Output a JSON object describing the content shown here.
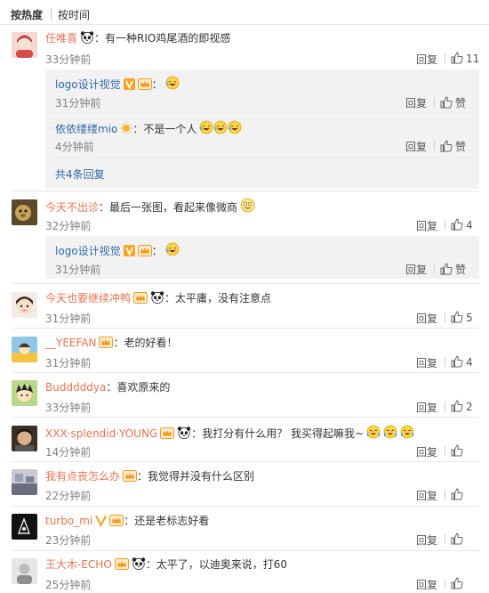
{
  "tabs": {
    "hot": "按热度",
    "time": "按时间"
  },
  "comments": [
    {
      "user": "任唯喜",
      "text": "：有一种RIO鸡尾酒的即视感",
      "time": "33分钟前",
      "reply": "回复",
      "likes": "11"
    },
    {
      "user": "今天不出诊",
      "text": "：最后一张图，看起来像微商",
      "time": "32分钟前",
      "reply": "回复",
      "likes": "4"
    },
    {
      "user": "今天也要继续冲鸭",
      "text": "：太平庸，没有注意点",
      "time": "31分钟前",
      "reply": "回复",
      "likes": "5"
    },
    {
      "user": "__YEEFAN",
      "text": "：老的好看！",
      "time": "31分钟前",
      "reply": "回复",
      "likes": "4"
    },
    {
      "user": "Budddddya",
      "text": "：喜欢原来的",
      "time": "33分钟前",
      "reply": "回复",
      "likes": "2"
    },
    {
      "user": "XXX·splendid·YOUNG",
      "text": "：我打分有什么用？ 我买得起嘛我~",
      "time": "14分钟前",
      "reply": "回复",
      "likes": ""
    },
    {
      "user": "我有点丧怎么办",
      "text": "：我觉得并没有什么区别",
      "time": "22分钟前",
      "reply": "回复",
      "likes": ""
    },
    {
      "user": "turbo_mi",
      "text": "：还是老标志好看",
      "time": "23分钟前",
      "reply": "回复",
      "likes": ""
    },
    {
      "user": "王大木-ECHO",
      "text": "：太平了，以迪奥来说，打60",
      "time": "25分钟前",
      "reply": "回复",
      "likes": ""
    }
  ],
  "replies": [
    {
      "user": "logo设计视觉",
      "text": "：",
      "time": "31分钟前",
      "reply": "回复",
      "like": "赞"
    },
    {
      "user": "依依缕缕mio",
      "text": "：不是一个人",
      "time": "4分钟前",
      "reply": "回复",
      "like": "赞"
    },
    {
      "user": "logo设计视觉",
      "text": "：",
      "time": "31分钟前",
      "reply": "回复",
      "like": "赞"
    }
  ],
  "more_replies": "共4条回复",
  "colors": {
    "username": "#eb7350",
    "link": "#2f6aa6",
    "reply_bg": "#f2f2f2",
    "time": "#808080"
  }
}
